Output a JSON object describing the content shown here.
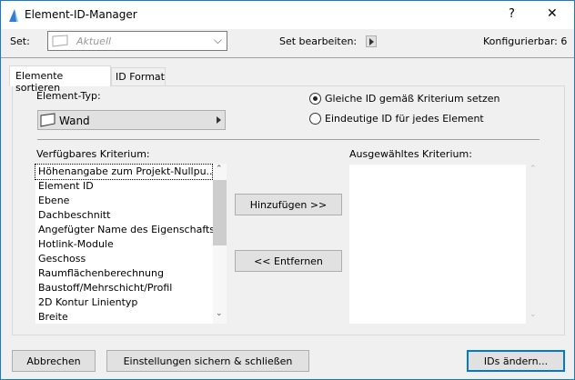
{
  "window": {
    "title": "Element-ID-Manager",
    "help": "?",
    "close": "✕"
  },
  "set": {
    "label": "Set:",
    "value": "Aktuell",
    "edit_label": "Set bearbeiten:",
    "configurable": "Konfigurierbar: 6"
  },
  "tabs": [
    {
      "label": "Elemente sortieren"
    },
    {
      "label": "ID Format"
    }
  ],
  "element_type": {
    "label": "Element-Typ:",
    "value": "Wand"
  },
  "radios": [
    {
      "label": "Gleiche ID gemäß Kriterium setzen",
      "checked": true
    },
    {
      "label": "Eindeutige ID für jedes Element",
      "checked": false
    }
  ],
  "available": {
    "label": "Verfügbares Kriterium:",
    "items": [
      "Höhenangabe zum Projekt-Nullpu...",
      "Element ID",
      "Ebene",
      "Dachbeschnitt",
      "Angefügter Name des Eigenschafts...",
      "Hotlink-Module",
      "Geschoss",
      "Raumflächenberechnung",
      "Baustoff/Mehrschicht/Profil",
      "2D Kontur Linientyp",
      "Breite"
    ]
  },
  "selected": {
    "label": "Ausgewähltes Kriterium:"
  },
  "buttons": {
    "add": "Hinzufügen >>",
    "remove": "<< Entfernen",
    "cancel": "Abbrechen",
    "save_close": "Einstellungen sichern & schließen",
    "change_ids": "IDs ändern..."
  }
}
